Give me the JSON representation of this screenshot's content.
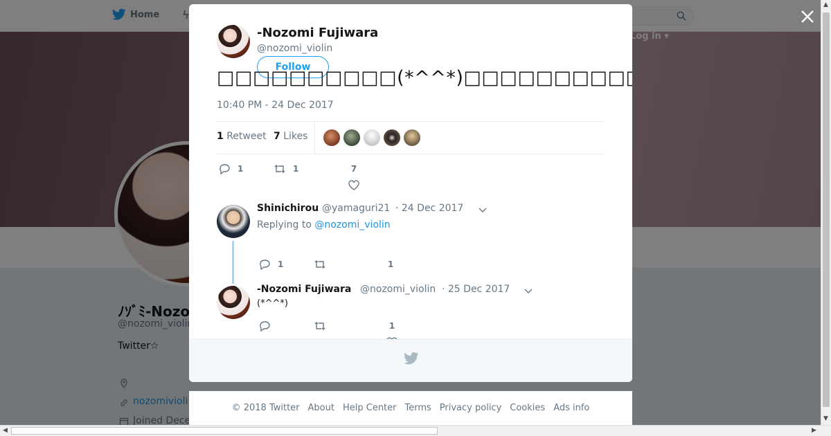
{
  "background": {
    "nav": {
      "home_label": "Home",
      "login_label": "Log in ▾"
    },
    "profile": {
      "name": "ﾉｿﾞﾐ-Nozo",
      "handle": "@nozomi_violin",
      "bio": "Twitter☆",
      "link": "nozomivioli",
      "joined": "Joined Dece"
    }
  },
  "modal": {
    "close_label": "×",
    "author": {
      "name": "-Nozomi Fujiwara",
      "handle": "@nozomi_violin"
    },
    "follow_label": "Follow",
    "tweet_text": "□□□□□□□□□□(*^^*)□□□□□□□□□□□□□□□□□□□□□□□□□□□□□□□□□□□",
    "timestamp": "10:40 PM - 24 Dec 2017",
    "stats": {
      "retweets_count": "1",
      "retweets_label": "Retweet",
      "likes_count": "7",
      "likes_label": "Likes",
      "liker_avatars": [
        {
          "color": "#8a4a2e"
        },
        {
          "color": "#5a6a58"
        },
        {
          "color": "#d8d8d8"
        },
        {
          "color": "#3a3030"
        },
        {
          "color": "#b08a60"
        }
      ]
    },
    "actions": {
      "replies": "1",
      "retweets": "1",
      "likes": "7"
    },
    "replies": [
      {
        "name": "Shinichirou",
        "handle": "@yamaguri21",
        "date": "· 24 Dec 2017",
        "replying_prefix": "Replying to",
        "replying_to": "@nozomi_violin",
        "actions": {
          "replies": "1",
          "retweets": "",
          "likes": "1"
        }
      },
      {
        "name": "-Nozomi Fujiwara",
        "handle": "@nozomi_violin",
        "date": "· 25 Dec 2017",
        "text": "(*^^*)",
        "actions": {
          "replies": "",
          "retweets": "",
          "likes": "1"
        }
      }
    ]
  },
  "footer": {
    "links": [
      "© 2018 Twitter",
      "About",
      "Help Center",
      "Terms",
      "Privacy policy",
      "Cookies",
      "Ads info"
    ]
  },
  "colors": {
    "accent": "#1da1f2",
    "link": "#1b95e0",
    "muted": "#657786",
    "thread": "#9fd7f7"
  }
}
